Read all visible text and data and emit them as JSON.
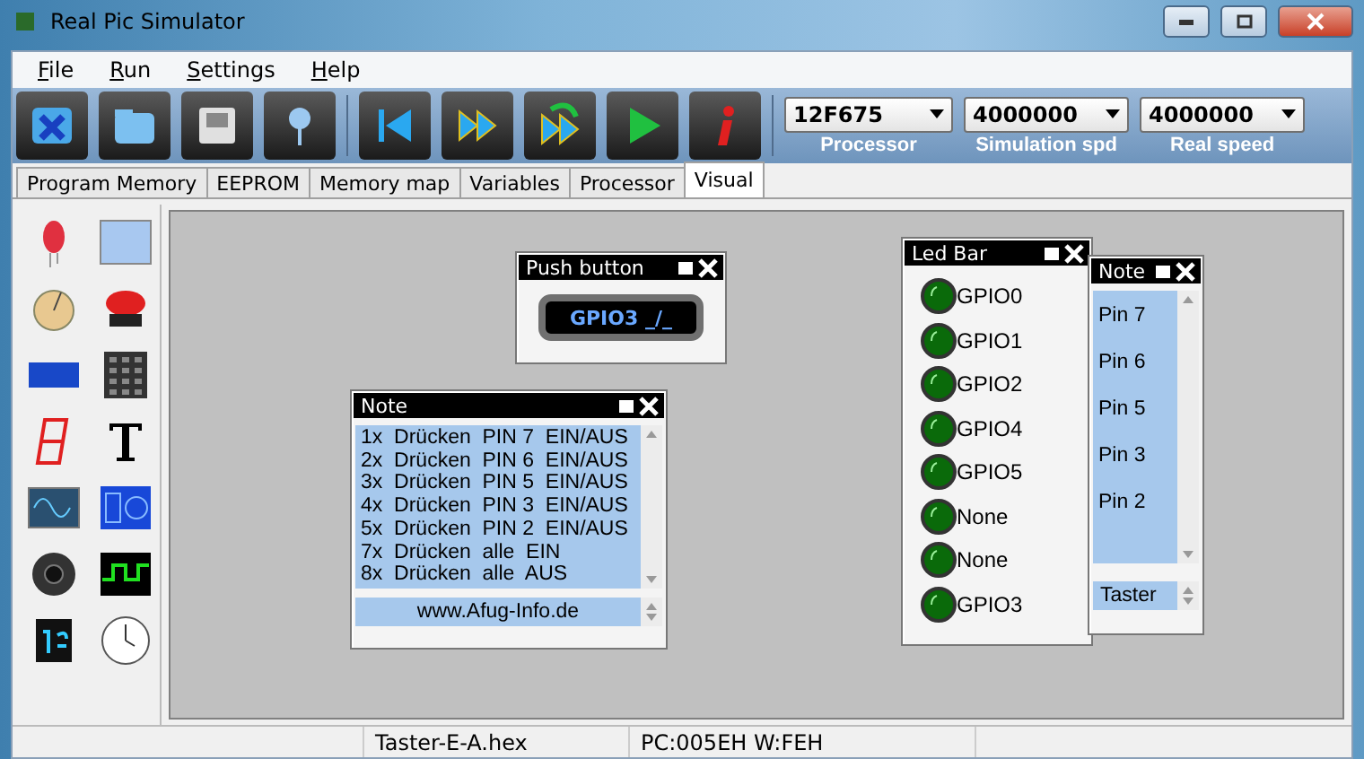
{
  "window": {
    "title": "Real Pic Simulator"
  },
  "menu": [
    "File",
    "Run",
    "Settings",
    "Help"
  ],
  "selectors": [
    {
      "value": "12F675",
      "label": "Processor"
    },
    {
      "value": "4000000",
      "label": "Simulation spd"
    },
    {
      "value": "4000000",
      "label": "Real speed"
    }
  ],
  "tabs": [
    {
      "label": "Program Memory",
      "selected": false
    },
    {
      "label": "EEPROM",
      "selected": false
    },
    {
      "label": "Memory map",
      "selected": false
    },
    {
      "label": "Variables",
      "selected": false
    },
    {
      "label": "Processor",
      "selected": false
    },
    {
      "label": "Visual",
      "selected": true
    }
  ],
  "push_button": {
    "title": "Push button",
    "label": "GPIO3 _/_"
  },
  "note": {
    "title": "Note",
    "lines": [
      "1x  Drücken  PIN 7  EIN/AUS",
      "2x  Drücken  PIN 6  EIN/AUS",
      "3x  Drücken  PIN 5  EIN/AUS",
      "4x  Drücken  PIN 3  EIN/AUS",
      "5x  Drücken  PIN 2  EIN/AUS",
      "7x  Drücken  alle  EIN",
      "8x  Drücken  alle  AUS"
    ],
    "footer": "www.Afug-Info.de"
  },
  "led_bar": {
    "title": "Led Bar",
    "leds": [
      "GPIO0",
      "GPIO1",
      "GPIO2",
      "GPIO4",
      "GPIO5",
      "None",
      "None",
      "GPIO3"
    ]
  },
  "pin_note": {
    "title": "Note",
    "lines": [
      "Pin 7",
      "Pin 6",
      "Pin 5",
      "Pin 3",
      "Pin 2"
    ],
    "footer": "Taster"
  },
  "status_bar": {
    "file": "Taster-E-A.hex",
    "registers": "PC:005EH W:FEH"
  }
}
